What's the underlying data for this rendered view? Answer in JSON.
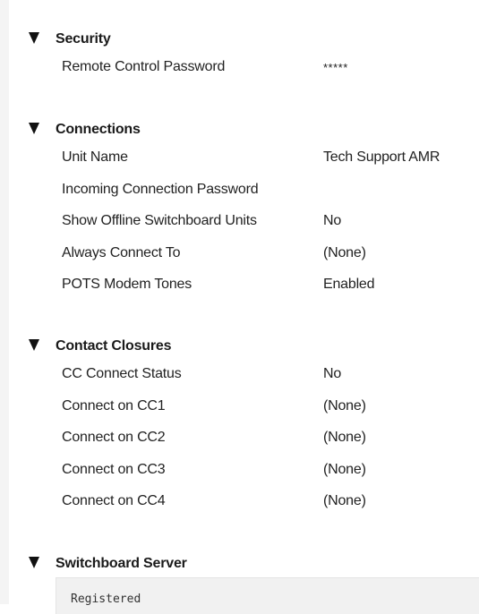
{
  "sections": [
    {
      "title": "Security",
      "rows": [
        {
          "label": "Remote Control Password",
          "value": "*****"
        }
      ]
    },
    {
      "title": "Connections",
      "rows": [
        {
          "label": "Unit Name",
          "value": "Tech Support AMR"
        },
        {
          "label": "Incoming Connection Password",
          "value": ""
        },
        {
          "label": "Show Offline Switchboard Units",
          "value": "No"
        },
        {
          "label": "Always Connect To",
          "value": "(None)"
        },
        {
          "label": "POTS Modem Tones",
          "value": "Enabled"
        }
      ]
    },
    {
      "title": "Contact Closures",
      "rows": [
        {
          "label": "CC Connect Status",
          "value": "No"
        },
        {
          "label": "Connect on CC1",
          "value": "(None)"
        },
        {
          "label": "Connect on CC2",
          "value": "(None)"
        },
        {
          "label": "Connect on CC3",
          "value": "(None)"
        },
        {
          "label": "Connect on CC4",
          "value": "(None)"
        }
      ]
    },
    {
      "title": "Switchboard Server",
      "status_text": "Registered"
    }
  ],
  "icons": {
    "section_toggle": "caret-down-icon"
  },
  "colors": {
    "text": "#222222",
    "caret": "#111111",
    "server_box": "#f1f1f1"
  }
}
